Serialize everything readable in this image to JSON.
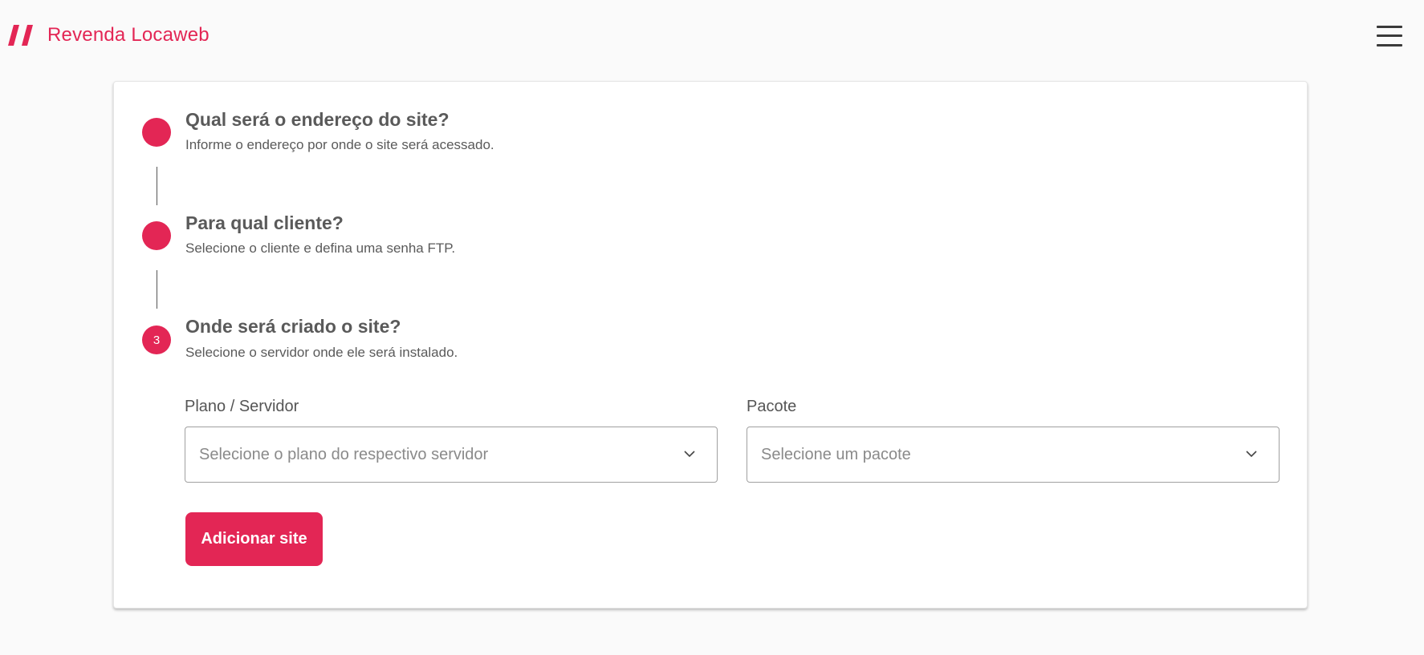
{
  "header": {
    "brand": "Revenda Locaweb",
    "logo_icon": "locaweb-slashes-icon",
    "menu_icon": "hamburger-menu-icon"
  },
  "colors": {
    "accent": "#e32655",
    "background": "#fafafa",
    "card": "#ffffff",
    "text": "#555555"
  },
  "steps": [
    {
      "number": "",
      "title": "Qual será o endereço do site?",
      "subtitle": "Informe o endereço por onde o site será acessado."
    },
    {
      "number": "",
      "title": "Para qual cliente?",
      "subtitle": "Selecione o cliente e defina uma senha FTP."
    },
    {
      "number": "3",
      "title": "Onde será criado o site?",
      "subtitle": "Selecione o servidor onde ele será instalado."
    }
  ],
  "form": {
    "plano": {
      "label": "Plano / Servidor",
      "placeholder": "Selecione o plano do respectivo servidor"
    },
    "pacote": {
      "label": "Pacote",
      "placeholder": "Selecione um pacote"
    },
    "submit_label": "Adicionar site"
  }
}
